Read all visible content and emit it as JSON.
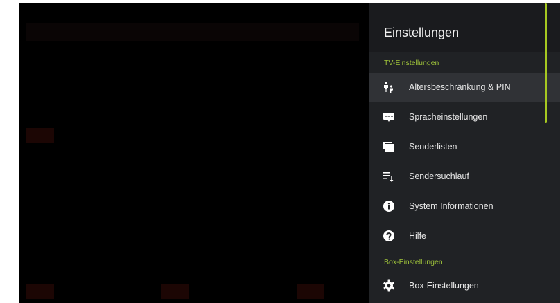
{
  "settings": {
    "title": "Einstellungen",
    "sections": [
      {
        "label": "TV-Einstellungen"
      },
      {
        "label": "Box-Einstellungen"
      }
    ],
    "tv_items": [
      {
        "label": "Altersbeschränkung & PIN",
        "icon": "child-lock-icon"
      },
      {
        "label": "Spracheinstellungen",
        "icon": "subtitles-icon"
      },
      {
        "label": "Senderlisten",
        "icon": "channel-list-icon"
      },
      {
        "label": "Sendersuchlauf",
        "icon": "channel-scan-icon"
      },
      {
        "label": "System Informationen",
        "icon": "info-icon"
      },
      {
        "label": "Hilfe",
        "icon": "help-icon"
      }
    ],
    "box_items": [
      {
        "label": "Box-Einstellungen",
        "icon": "gear-icon"
      }
    ],
    "selected_item": "Altersbeschränkung & PIN"
  },
  "colors": {
    "accent": "#a6c821",
    "section_label": "#9fc43a",
    "panel_bg": "#202225",
    "selected_bg": "#303236"
  }
}
